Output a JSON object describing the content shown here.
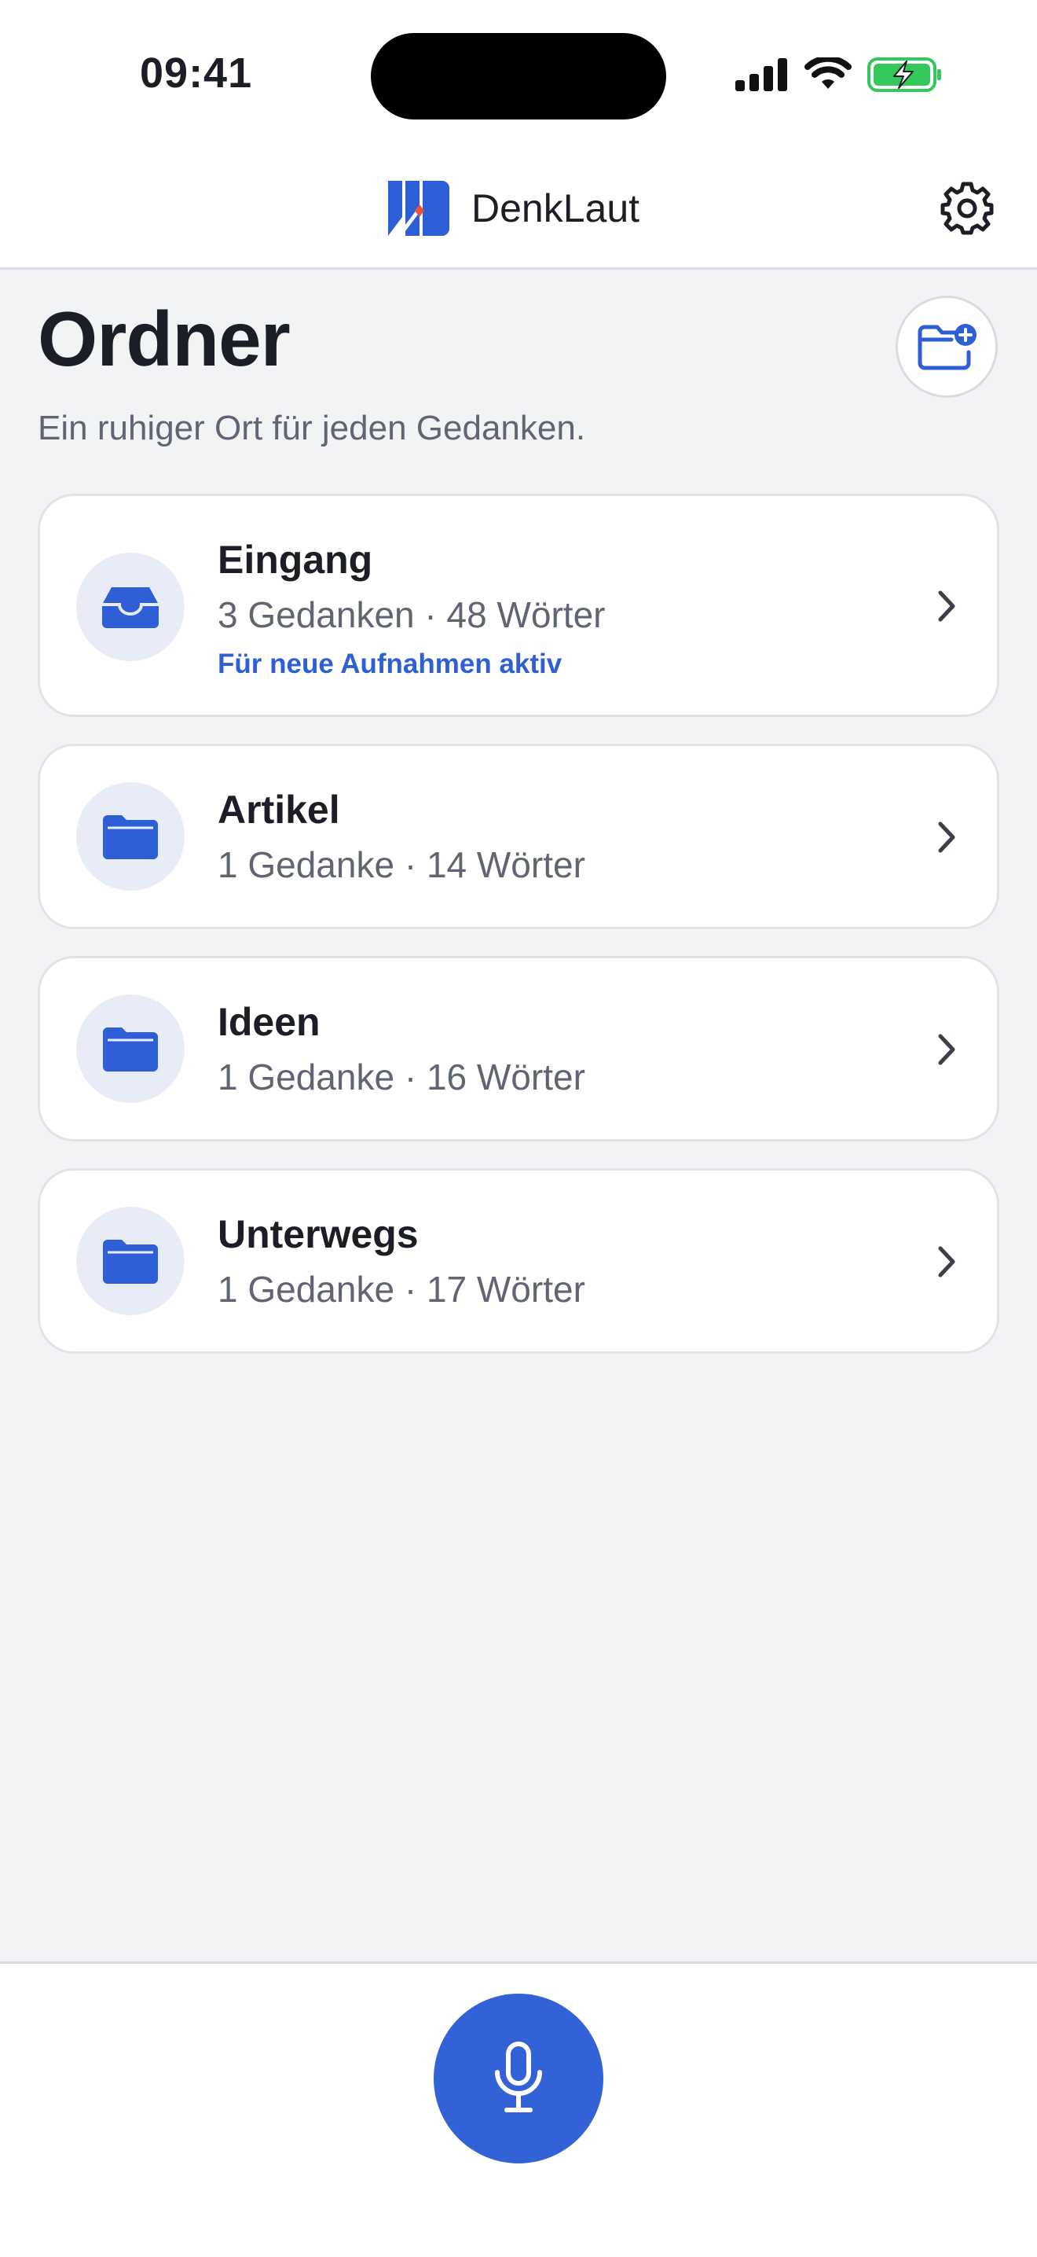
{
  "status": {
    "time": "09:41"
  },
  "header": {
    "app_name": "DenkLaut"
  },
  "page": {
    "title": "Ordner",
    "subtitle": "Ein ruhiger Ort für jeden Gedanken."
  },
  "folders": [
    {
      "name": "Eingang",
      "meta": "3 Gedanken · 48 Wörter",
      "note": "Für neue Aufnahmen aktiv",
      "icon": "inbox-icon"
    },
    {
      "name": "Artikel",
      "meta": "1 Gedanke · 14 Wörter",
      "icon": "folder-icon"
    },
    {
      "name": "Ideen",
      "meta": "1 Gedanke · 16 Wörter",
      "icon": "folder-icon"
    },
    {
      "name": "Unterwegs",
      "meta": "1 Gedanke · 17 Wörter",
      "icon": "folder-icon"
    }
  ],
  "colors": {
    "accent": "#3361d6",
    "background": "#f2f3f5",
    "battery": "#34c759"
  }
}
